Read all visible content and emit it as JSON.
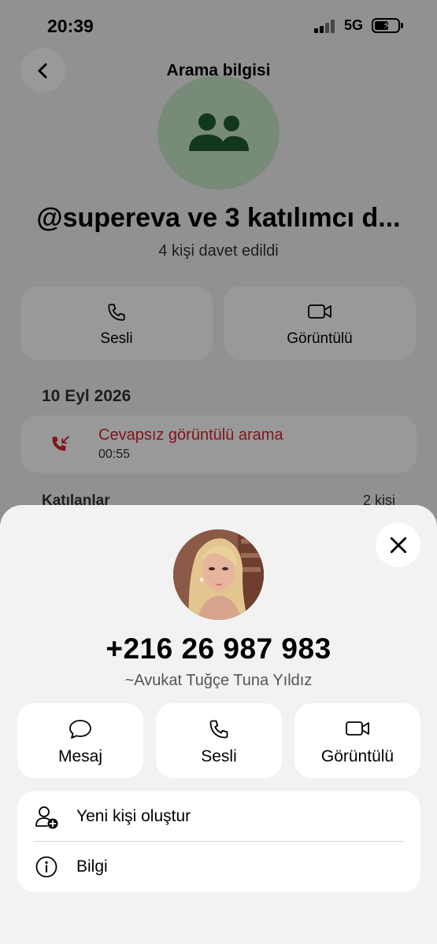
{
  "status_bar": {
    "time": "20:39",
    "network": "5G",
    "battery_percent": 60
  },
  "header": {
    "title": "Arama bilgisi",
    "back_icon": "chevron-left-icon"
  },
  "call": {
    "name": "@supereva ve 3 katılımcı d...",
    "subtitle": "4 kişi davet edildi",
    "avatar_icon": "group-icon",
    "avatar_color": "#c8e6c9"
  },
  "call_actions": [
    {
      "label": "Sesli",
      "icon": "phone-icon"
    },
    {
      "label": "Görüntülü",
      "icon": "video-icon"
    }
  ],
  "history": {
    "date": "10 Eyl 2026",
    "entry": {
      "title": "Cevapsız görüntülü arama",
      "duration": "00:55",
      "icon": "missed-call-icon",
      "color": "#d9232f"
    }
  },
  "participants": {
    "label": "Katılanlar",
    "count": "2 kişi"
  },
  "sheet": {
    "close_icon": "close-icon",
    "phone": "+216 26 987 983",
    "name": "~Avukat Tuğçe Tuna Yıldız",
    "actions": [
      {
        "label": "Mesaj",
        "icon": "message-icon"
      },
      {
        "label": "Sesli",
        "icon": "phone-icon"
      },
      {
        "label": "Görüntülü",
        "icon": "video-icon"
      }
    ],
    "menu": [
      {
        "label": "Yeni kişi oluştur",
        "icon": "add-person-icon"
      },
      {
        "label": "Bilgi",
        "icon": "info-icon"
      }
    ]
  }
}
